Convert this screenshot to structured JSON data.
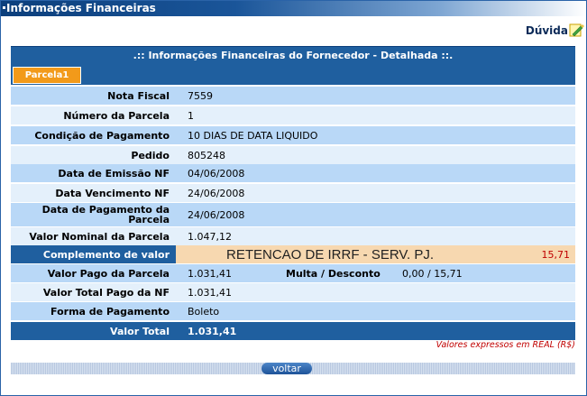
{
  "window": {
    "title": "Informações Financeiras"
  },
  "help": {
    "label": "Dúvida",
    "icon": "help-pencil-icon"
  },
  "header": {
    "title": ".:: Informações Financeiras do Fornecedor - Detalhada ::."
  },
  "tabs": [
    {
      "label": "Parcela1",
      "active": true
    }
  ],
  "rows": {
    "nota_fiscal": {
      "label": "Nota Fiscal",
      "value": "7559"
    },
    "numero_parcela": {
      "label": "Número da Parcela",
      "value": "1"
    },
    "condicao_pagamento": {
      "label": "Condição de Pagamento",
      "value": "10 DIAS DE DATA LIQUIDO"
    },
    "pedido": {
      "label": "Pedido",
      "value": "805248"
    },
    "data_emissao": {
      "label": "Data de Emissão NF",
      "value": "04/06/2008"
    },
    "data_vencimento": {
      "label": "Data Vencimento NF",
      "value": "24/06/2008"
    },
    "data_pagamento": {
      "label": "Data de Pagamento da Parcela",
      "value": "24/06/2008"
    },
    "valor_nominal": {
      "label": "Valor Nominal da Parcela",
      "value": "1.047,12"
    },
    "complemento": {
      "label": "Complemento de valor",
      "text": "RETENCAO DE IRRF - SERV. PJ.",
      "value": "15,71"
    },
    "valor_pago": {
      "label": "Valor Pago da Parcela",
      "value": "1.031,41",
      "multa_label": "Multa / Desconto",
      "multa_value": "0,00 /  15,71"
    },
    "valor_total_nf": {
      "label": "Valor Total Pago da NF",
      "value": "1.031,41"
    },
    "forma_pagamento": {
      "label": "Forma de Pagamento",
      "value": "Boleto"
    },
    "valor_total": {
      "label": "Valor Total",
      "value": "1.031,41"
    }
  },
  "note": "Valores expressos em REAL (R$)",
  "actions": {
    "back_label": "voltar"
  },
  "colors": {
    "header_blue": "#1f5f9f",
    "row_dark": "#b9d8f7",
    "row_light": "#e4f0fb",
    "tab_orange": "#f29a1a",
    "complemento_bg": "#f7d8b0",
    "alert_red": "#c00000"
  }
}
